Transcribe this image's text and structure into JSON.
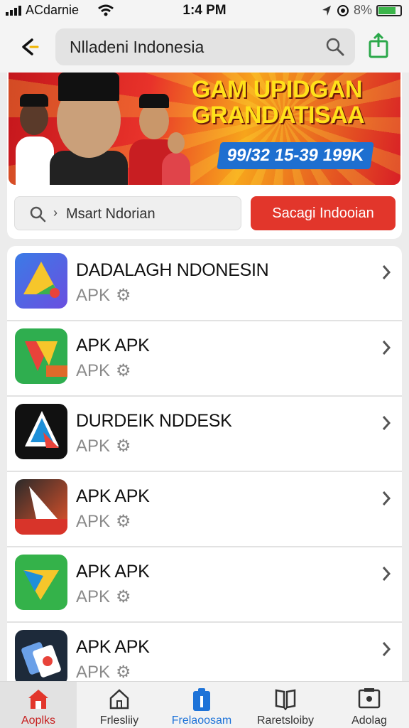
{
  "status_bar": {
    "carrier": "ACdarnie",
    "time": "1:4 PM",
    "battery_text": "8%"
  },
  "top_bar": {
    "search_query": "Nlladeni Indonesia"
  },
  "banner": {
    "headline_line1": "GAM UPIDGAN",
    "headline_line2": "GRANDATISAA",
    "price_text": "99/32 15-39 199K"
  },
  "mini_search": {
    "text": "Msart Ndorian"
  },
  "action_button": {
    "label": "Sacagi Indooian"
  },
  "apps": [
    {
      "title": "DADALAGH NDONESIN",
      "subtitle": "APK",
      "icon": "drive-triangle-icon"
    },
    {
      "title": "APK APK",
      "subtitle": "APK",
      "icon": "green-red-app-icon"
    },
    {
      "title": "DURDEIK NDDESK",
      "subtitle": "APK",
      "icon": "black-shield-app-icon"
    },
    {
      "title": "APK APK",
      "subtitle": "APK",
      "icon": "orange-desk-app-icon"
    },
    {
      "title": "APK APK",
      "subtitle": "APK",
      "icon": "green-play-app-icon"
    },
    {
      "title": "APK APK",
      "subtitle": "APK",
      "icon": "dark-cards-app-icon"
    }
  ],
  "bottom_nav": [
    {
      "label": "Aoplks",
      "icon": "home-icon"
    },
    {
      "label": "Frlesliiy",
      "icon": "house-outline-icon"
    },
    {
      "label": "Frelaoosam",
      "icon": "clipboard-icon"
    },
    {
      "label": "Raretsloiby",
      "icon": "book-icon"
    },
    {
      "label": "Adolag",
      "icon": "screen-icon"
    }
  ],
  "colors": {
    "accent_red": "#e2362b",
    "active_blue": "#1e73d8",
    "banner_yellow": "#ffe11a"
  }
}
